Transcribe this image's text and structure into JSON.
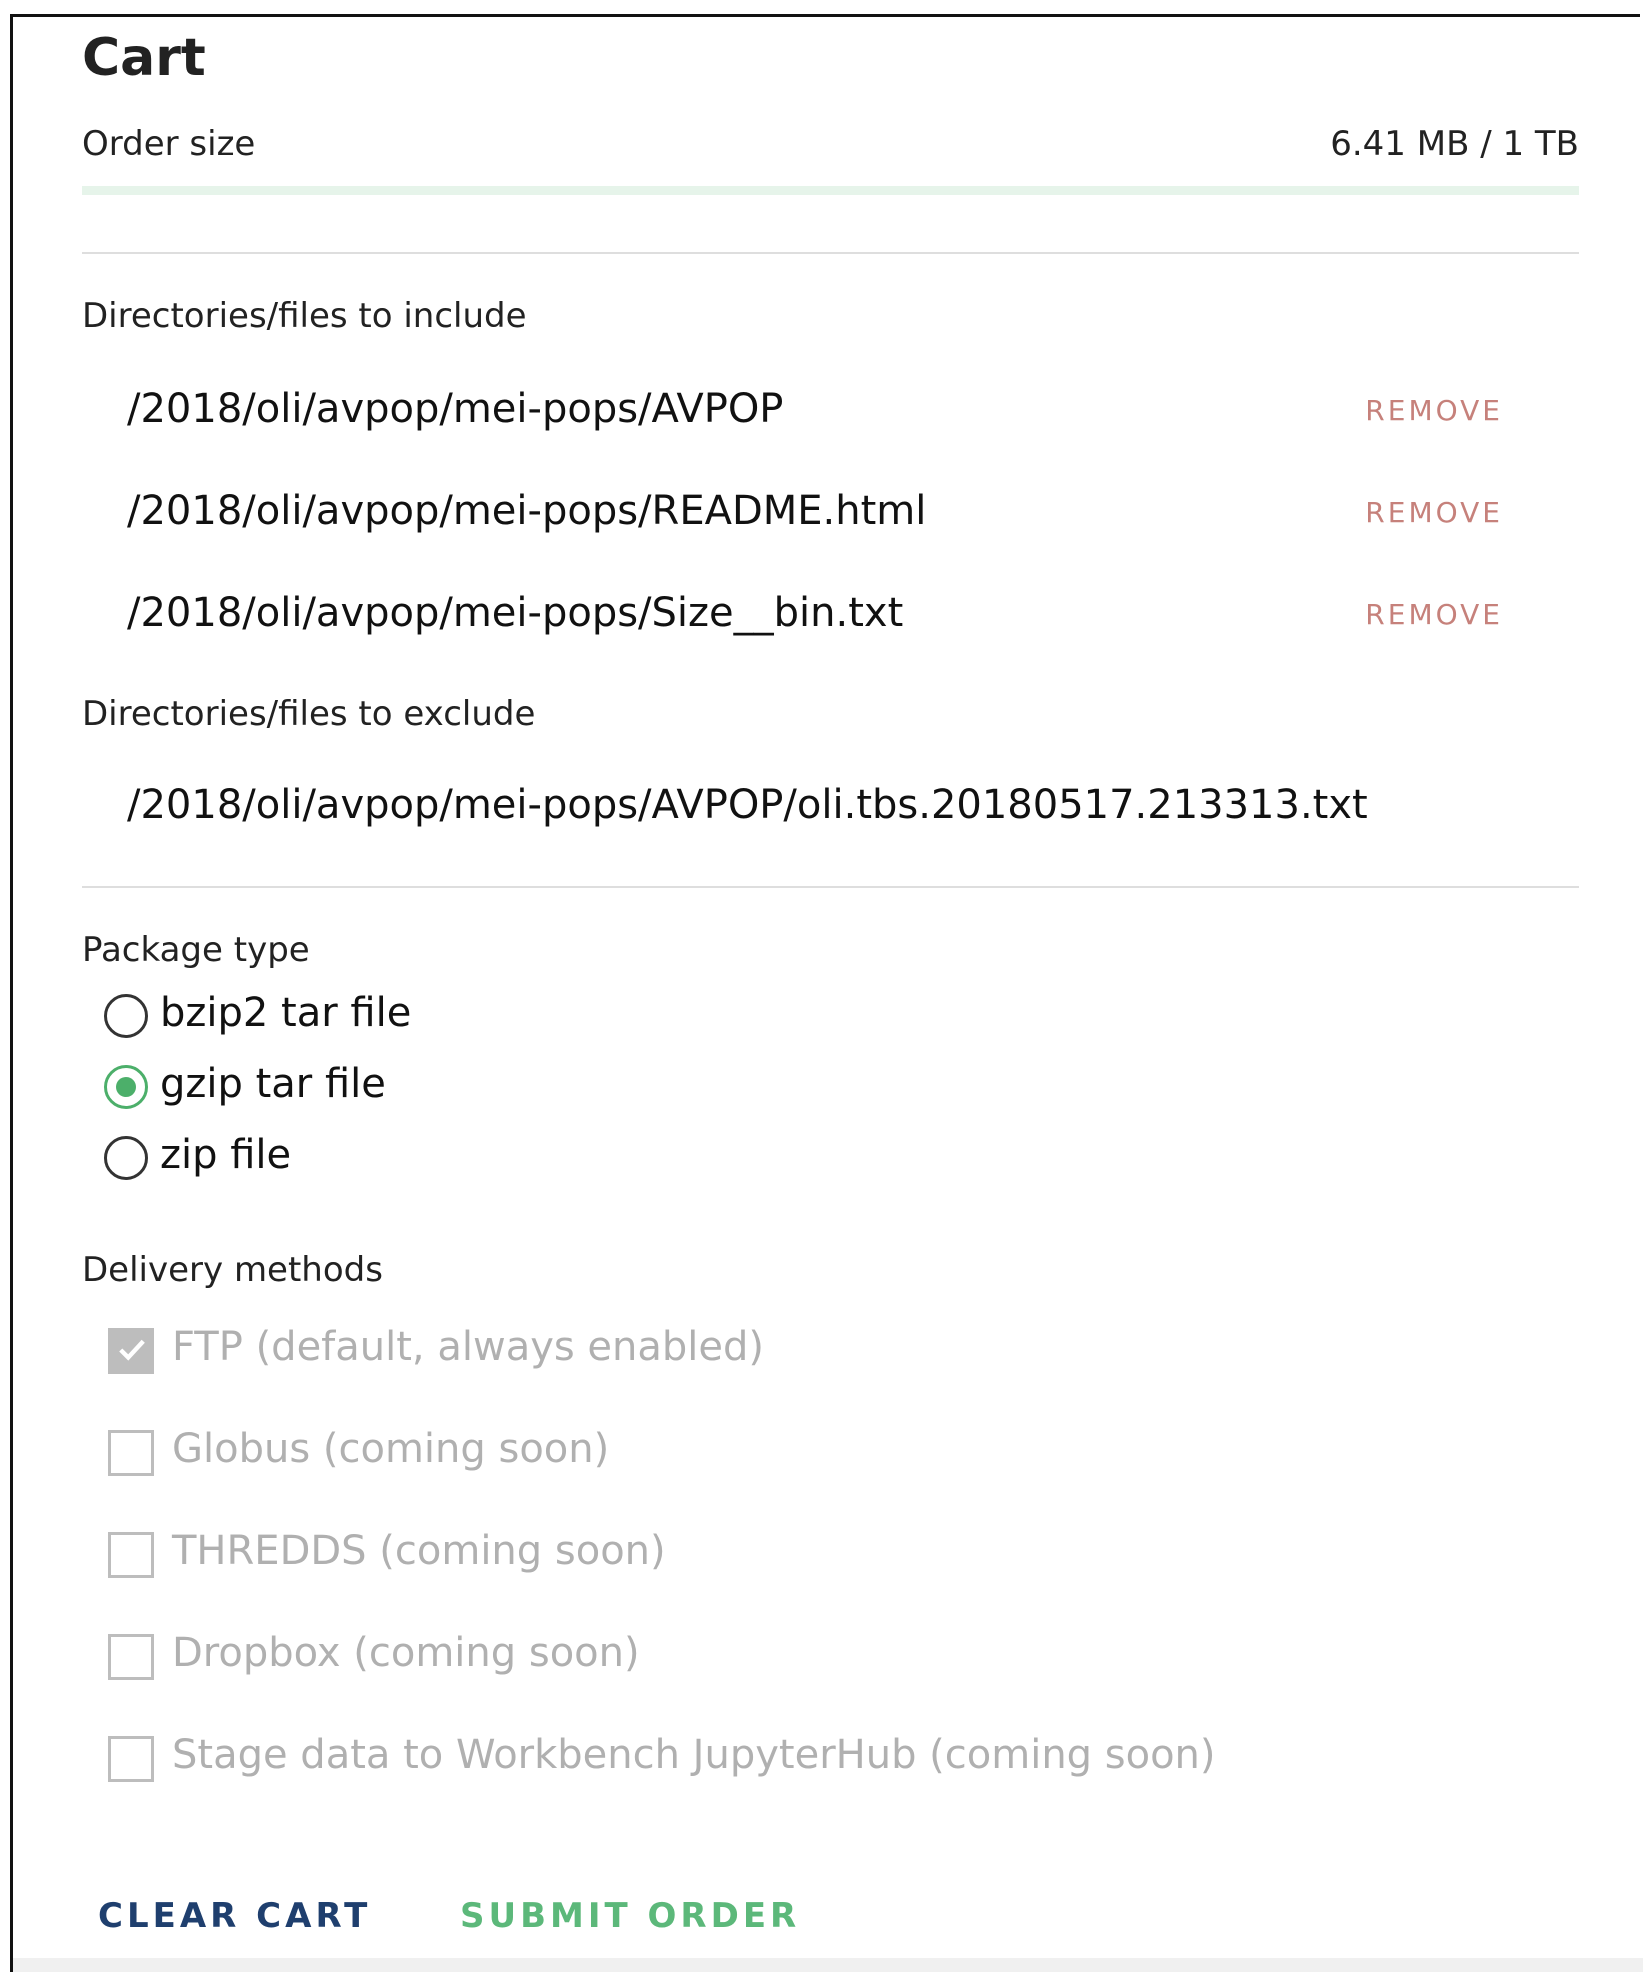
{
  "cart": {
    "title": "Cart",
    "order_size_label": "Order size",
    "order_size_value": "6.41 MB / 1 TB",
    "order_size_fraction": 6.4e-06
  },
  "include": {
    "label": "Directories/files to include",
    "remove_label": "REMOVE",
    "items": [
      "/2018/oli/avpop/mei-pops/AVPOP",
      "/2018/oli/avpop/mei-pops/README.html",
      "/2018/oli/avpop/mei-pops/Size__bin.txt"
    ]
  },
  "exclude": {
    "label": "Directories/files to exclude",
    "items": [
      "/2018/oli/avpop/mei-pops/AVPOP/oli.tbs.20180517.213313.txt"
    ]
  },
  "package": {
    "label": "Package type",
    "selected": "gzip tar file",
    "options": [
      "bzip2 tar file",
      "gzip tar file",
      "zip file"
    ]
  },
  "delivery": {
    "label": "Delivery methods",
    "options": [
      {
        "label": "FTP (default, always enabled)",
        "checked": true,
        "disabled": true
      },
      {
        "label": "Globus (coming soon)",
        "checked": false,
        "disabled": true
      },
      {
        "label": "THREDDS (coming soon)",
        "checked": false,
        "disabled": true
      },
      {
        "label": "Dropbox (coming soon)",
        "checked": false,
        "disabled": true
      },
      {
        "label": "Stage data to Workbench JupyterHub (coming soon)",
        "checked": false,
        "disabled": true
      }
    ]
  },
  "actions": {
    "clear_label": "CLEAR CART",
    "submit_label": "SUBMIT ORDER"
  },
  "colors": {
    "accent_green": "#4caf6a",
    "remove_red": "#c6817b",
    "clear_blue": "#1f3f6e",
    "disabled_gray": "#b0b0b0"
  }
}
